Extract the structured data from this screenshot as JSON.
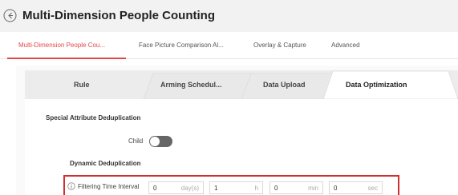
{
  "header": {
    "title": "Multi-Dimension People Counting"
  },
  "sub_tabs": [
    {
      "label": "Multi-Dimension People Cou...",
      "active": true
    },
    {
      "label": "Face Picture Comparison Al...",
      "active": false
    },
    {
      "label": "Overlay & Capture",
      "active": false
    },
    {
      "label": "Advanced",
      "active": false
    }
  ],
  "tabs": [
    {
      "label": "Rule",
      "active": false
    },
    {
      "label": "Arming Schedul...",
      "active": false
    },
    {
      "label": "Data Upload",
      "active": false
    },
    {
      "label": "Data Optimization",
      "active": true
    }
  ],
  "special_dedup": {
    "title": "Special Attribute Deduplication",
    "child_label": "Child",
    "child_enabled": false
  },
  "dynamic_dedup": {
    "title": "Dynamic Deduplication",
    "filtering_label": "Filtering Time Interval",
    "fields": [
      {
        "value": "0",
        "unit": "day(s)"
      },
      {
        "value": "1",
        "unit": "h"
      },
      {
        "value": "0",
        "unit": "min"
      },
      {
        "value": "0",
        "unit": "sec"
      }
    ]
  },
  "colors": {
    "accent": "#e14848",
    "highlight_border": "#d32f2f",
    "toggle_off": "#666666"
  },
  "icons": {
    "back": "back-arrow-circle-icon",
    "info": "info-circle-icon"
  }
}
